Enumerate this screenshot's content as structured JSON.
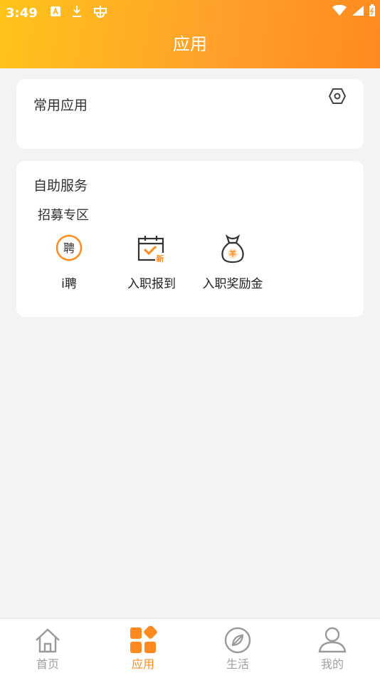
{
  "status_bar": {
    "time": "3:49"
  },
  "header": {
    "title": "应用"
  },
  "common_apps": {
    "title": "常用应用"
  },
  "self_service": {
    "title": "自助服务",
    "section": "招募专区",
    "apps": [
      {
        "label": "i聘",
        "icon": "pin-badge-icon",
        "badge_text": "聘"
      },
      {
        "label": "入职报到",
        "icon": "calendar-check-icon",
        "badge_text": "新"
      },
      {
        "label": "入职奖励金",
        "icon": "money-bag-icon",
        "badge_text": "羊"
      }
    ]
  },
  "tabbar": {
    "tabs": [
      {
        "label": "首页",
        "icon": "home-icon",
        "active": false
      },
      {
        "label": "应用",
        "icon": "apps-grid-icon",
        "active": true
      },
      {
        "label": "生活",
        "icon": "compass-icon",
        "active": false
      },
      {
        "label": "我的",
        "icon": "profile-icon",
        "active": false
      }
    ]
  },
  "colors": {
    "accent": "#ff8a1f",
    "header_start": "#ffc41a",
    "header_end": "#ff8a1f"
  }
}
